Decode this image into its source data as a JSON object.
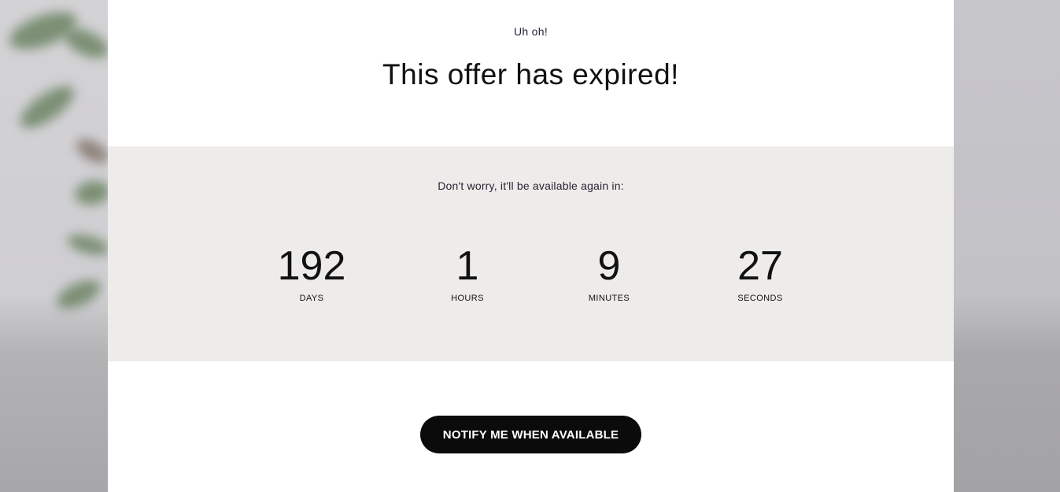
{
  "offer": {
    "eyebrow": "Uh oh!",
    "title": "This offer has expired!"
  },
  "countdown": {
    "subtitle": "Don't worry, it'll be available again in:",
    "units": [
      {
        "value": "192",
        "label": "DAYS"
      },
      {
        "value": "1",
        "label": "HOURS"
      },
      {
        "value": "9",
        "label": "MINUTES"
      },
      {
        "value": "27",
        "label": "SECONDS"
      }
    ]
  },
  "cta": {
    "label": "NOTIFY ME WHEN AVAILABLE"
  },
  "colors": {
    "card_background": "#ffffff",
    "countdown_background": "#eeecea",
    "button_background": "#0b0b0b",
    "button_text": "#ffffff",
    "text": "#111111"
  }
}
